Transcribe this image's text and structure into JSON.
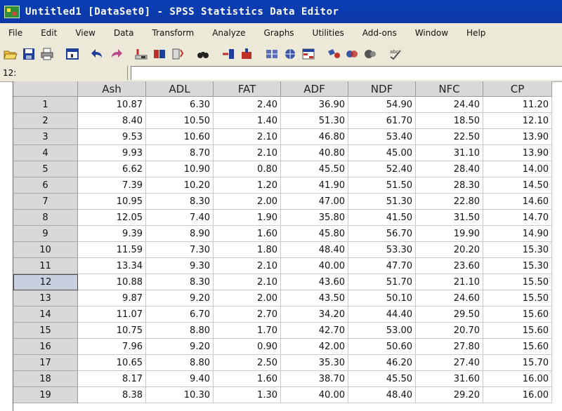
{
  "window": {
    "title": "Untitled1 [DataSet0] - SPSS Statistics Data Editor"
  },
  "menu": [
    "File",
    "Edit",
    "View",
    "Data",
    "Transform",
    "Analyze",
    "Graphs",
    "Utilities",
    "Add-ons",
    "Window",
    "Help"
  ],
  "toolbar_icons": [
    "open-icon",
    "save-icon",
    "print-icon",
    "dialog-recall-icon",
    "undo-icon",
    "redo-icon",
    "goto-case-icon",
    "goto-variable-icon",
    "variables-icon",
    "find-icon",
    "insert-cases-icon",
    "insert-variable-icon",
    "split-file-icon",
    "weight-cases-icon",
    "select-cases-icon",
    "value-labels-icon",
    "use-sets-icon",
    "show-all-icon",
    "spelling-icon"
  ],
  "cell_editor": {
    "reference": "12:",
    "value": ""
  },
  "columns": [
    "Ash",
    "ADL",
    "FAT",
    "ADF",
    "NDF",
    "NFC",
    "CP"
  ],
  "selected_row": 12,
  "rows": [
    {
      "n": "1",
      "v": [
        "10.87",
        "6.30",
        "2.40",
        "36.90",
        "54.90",
        "24.40",
        "11.20"
      ]
    },
    {
      "n": "2",
      "v": [
        "8.40",
        "10.50",
        "1.40",
        "51.30",
        "61.70",
        "18.50",
        "12.10"
      ]
    },
    {
      "n": "3",
      "v": [
        "9.53",
        "10.60",
        "2.10",
        "46.80",
        "53.40",
        "22.50",
        "13.90"
      ]
    },
    {
      "n": "4",
      "v": [
        "9.93",
        "8.70",
        "2.10",
        "40.80",
        "45.00",
        "31.10",
        "13.90"
      ]
    },
    {
      "n": "5",
      "v": [
        "6.62",
        "10.90",
        "0.80",
        "45.50",
        "52.40",
        "28.40",
        "14.00"
      ]
    },
    {
      "n": "6",
      "v": [
        "7.39",
        "10.20",
        "1.20",
        "41.90",
        "51.50",
        "28.30",
        "14.50"
      ]
    },
    {
      "n": "7",
      "v": [
        "10.95",
        "8.30",
        "2.00",
        "47.00",
        "51.30",
        "22.80",
        "14.60"
      ]
    },
    {
      "n": "8",
      "v": [
        "12.05",
        "7.40",
        "1.90",
        "35.80",
        "41.50",
        "31.50",
        "14.70"
      ]
    },
    {
      "n": "9",
      "v": [
        "9.39",
        "8.90",
        "1.60",
        "45.80",
        "56.70",
        "19.90",
        "14.90"
      ]
    },
    {
      "n": "10",
      "v": [
        "11.59",
        "7.30",
        "1.80",
        "48.40",
        "53.30",
        "20.20",
        "15.30"
      ]
    },
    {
      "n": "11",
      "v": [
        "13.34",
        "9.30",
        "2.10",
        "40.00",
        "47.70",
        "23.60",
        "15.30"
      ]
    },
    {
      "n": "12",
      "v": [
        "10.88",
        "8.30",
        "2.10",
        "43.60",
        "51.70",
        "21.10",
        "15.50"
      ]
    },
    {
      "n": "13",
      "v": [
        "9.87",
        "9.20",
        "2.00",
        "43.50",
        "50.10",
        "24.60",
        "15.50"
      ]
    },
    {
      "n": "14",
      "v": [
        "11.07",
        "6.70",
        "2.70",
        "34.20",
        "44.40",
        "29.50",
        "15.60"
      ]
    },
    {
      "n": "15",
      "v": [
        "10.75",
        "8.80",
        "1.70",
        "42.70",
        "53.00",
        "20.70",
        "15.60"
      ]
    },
    {
      "n": "16",
      "v": [
        "7.96",
        "9.20",
        "0.90",
        "42.00",
        "50.60",
        "27.80",
        "15.60"
      ]
    },
    {
      "n": "17",
      "v": [
        "10.65",
        "8.80",
        "2.50",
        "35.30",
        "46.20",
        "27.40",
        "15.70"
      ]
    },
    {
      "n": "18",
      "v": [
        "8.17",
        "9.40",
        "1.60",
        "38.70",
        "45.50",
        "31.60",
        "16.00"
      ]
    },
    {
      "n": "19",
      "v": [
        "8.38",
        "10.30",
        "1.30",
        "40.00",
        "48.40",
        "29.20",
        "16.00"
      ]
    }
  ]
}
